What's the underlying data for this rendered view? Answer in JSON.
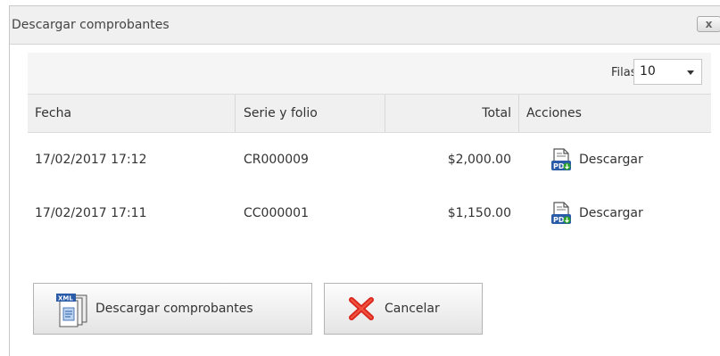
{
  "dialog": {
    "title": "Descargar comprobantes",
    "close_label": "x"
  },
  "pager": {
    "label": "Filas",
    "rows_value": "10"
  },
  "table": {
    "columns": [
      "Fecha",
      "Serie y folio",
      "Total",
      "Acciones"
    ],
    "rows": [
      {
        "fecha": "17/02/2017 17:12",
        "serie": "CR000009",
        "total": "$2,000.00",
        "action": "Descargar"
      },
      {
        "fecha": "17/02/2017 17:11",
        "serie": "CC000001",
        "total": "$1,150.00",
        "action": "Descargar"
      }
    ]
  },
  "buttons": {
    "download_label": "Descargar comprobantes",
    "cancel_label": "Cancelar"
  },
  "icons": {
    "pdf": "pdf-download-icon",
    "xml": "xml-files-icon",
    "cancel": "red-x-icon"
  },
  "colors": {
    "cancel_red": "#d9261c",
    "pdf_blue": "#2a5ba8",
    "download_green": "#2aa12a"
  }
}
